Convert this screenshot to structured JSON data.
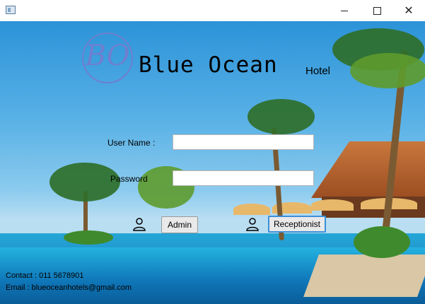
{
  "window": {
    "minimize": "—",
    "maximize": "",
    "close": "✕"
  },
  "brand": {
    "logo_text": "BO",
    "name": "Blue Ocean",
    "sub": "Hotel"
  },
  "form": {
    "username_label": "User Name :",
    "username_value": "",
    "password_label": "Password",
    "password_value": ""
  },
  "buttons": {
    "admin": "Admin",
    "receptionist": "Receptionist"
  },
  "footer": {
    "contact": "Contact : 011 5678901",
    "email": "Email : blueoceanhotels@gmail.com"
  },
  "icons": {
    "app": "app-icon",
    "admin": "user-icon",
    "receptionist": "user-icon"
  }
}
